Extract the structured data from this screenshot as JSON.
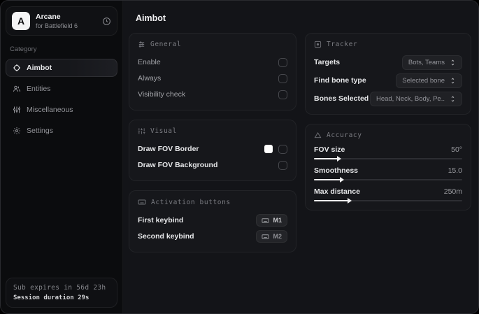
{
  "app": {
    "logo_letter": "A",
    "name": "Arcane",
    "subtitle": "for Battlefield 6"
  },
  "sidebar": {
    "category_label": "Category",
    "items": [
      {
        "label": "Aimbot",
        "active": true
      },
      {
        "label": "Entities",
        "active": false
      },
      {
        "label": "Miscellaneous",
        "active": false
      },
      {
        "label": "Settings",
        "active": false
      }
    ],
    "sub_status": {
      "line1": "Sub expires in 56d 23h",
      "line2": "Session duration 29s"
    }
  },
  "main": {
    "title": "Aimbot",
    "cards": {
      "general": {
        "title": "General",
        "rows": [
          {
            "label": "Enable",
            "checked": false
          },
          {
            "label": "Always",
            "checked": false
          },
          {
            "label": "Visibility check",
            "checked": false
          }
        ]
      },
      "visual": {
        "title": "Visual",
        "rows": [
          {
            "label": "Draw FOV Border",
            "checked": false,
            "swatch_color": "#ffffff"
          },
          {
            "label": "Draw FOV Background",
            "checked": false
          }
        ]
      },
      "activation": {
        "title": "Activation buttons",
        "rows": [
          {
            "label": "First keybind",
            "key": "M1"
          },
          {
            "label": "Second keybind",
            "key": "M2"
          }
        ]
      },
      "tracker": {
        "title": "Tracker",
        "rows": [
          {
            "label": "Targets",
            "value": "Bots, Teams"
          },
          {
            "label": "Find bone type",
            "value": "Selected bone"
          },
          {
            "label": "Bones Selected",
            "value": "Head, Neck, Body, Pe.."
          }
        ]
      },
      "accuracy": {
        "title": "Accuracy",
        "sliders": [
          {
            "label": "FOV size",
            "value": "50°",
            "percent": 16
          },
          {
            "label": "Smoothness",
            "value": "15.0",
            "percent": 18
          },
          {
            "label": "Max distance",
            "value": "250m",
            "percent": 23
          }
        ]
      }
    }
  },
  "colors": {
    "accent": "#f2f2f3",
    "card_bg": "#16171b",
    "sidebar_bg": "#0b0c0e",
    "main_bg": "#131418"
  }
}
